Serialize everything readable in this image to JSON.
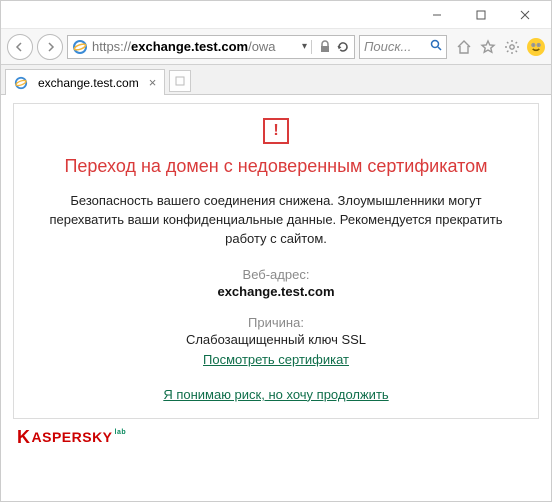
{
  "window": {
    "url_prefix": "https://",
    "url_bold": "exchange.test.com",
    "url_suffix": "/owa",
    "search_placeholder": "Поиск...",
    "tab_title": "exchange.test.com"
  },
  "page": {
    "warn_mark": "!",
    "title": "Переход на домен с недоверенным сертификатом",
    "body": "Безопасность вашего соединения снижена. Злоумышленники могут перехватить ваши конфиденциальные данные. Рекомендуется прекратить работу с сайтом.",
    "addr_label": "Веб-адрес:",
    "addr_value": "exchange.test.com",
    "reason_label": "Причина:",
    "reason_value": "Слабозащищенный ключ SSL",
    "view_cert": "Посмотреть сертификат",
    "proceed": "Я понимаю риск, но хочу продолжить"
  },
  "brand": {
    "name": "KASPERSKY",
    "sub": "lab"
  }
}
